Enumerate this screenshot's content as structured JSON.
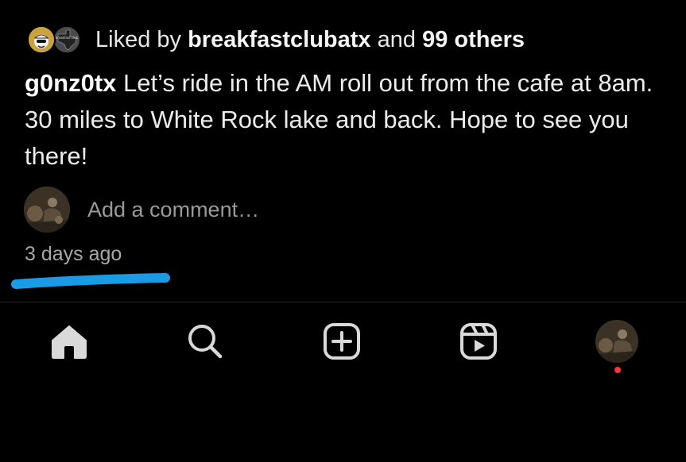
{
  "likes": {
    "prefix": "Liked by ",
    "user": "breakfastclubatx",
    "middle": " and ",
    "others": "99 others",
    "avatar_labels": [
      "",
      "breakfast club"
    ]
  },
  "caption": {
    "username": "g0nz0tx",
    "text": " Let’s ride in the AM roll out from the cafe at 8am. 30 miles to White Rock lake and back. Hope to see you there!"
  },
  "comment": {
    "placeholder": "Add a comment…"
  },
  "timestamp": "3 days ago",
  "annotation": {
    "color": "#1a9be6"
  },
  "nav": {
    "items": [
      {
        "icon": "home-icon"
      },
      {
        "icon": "search-icon"
      },
      {
        "icon": "create-post-icon"
      },
      {
        "icon": "reels-icon"
      },
      {
        "icon": "profile-avatar"
      }
    ],
    "notification_color": "#ff3040"
  }
}
